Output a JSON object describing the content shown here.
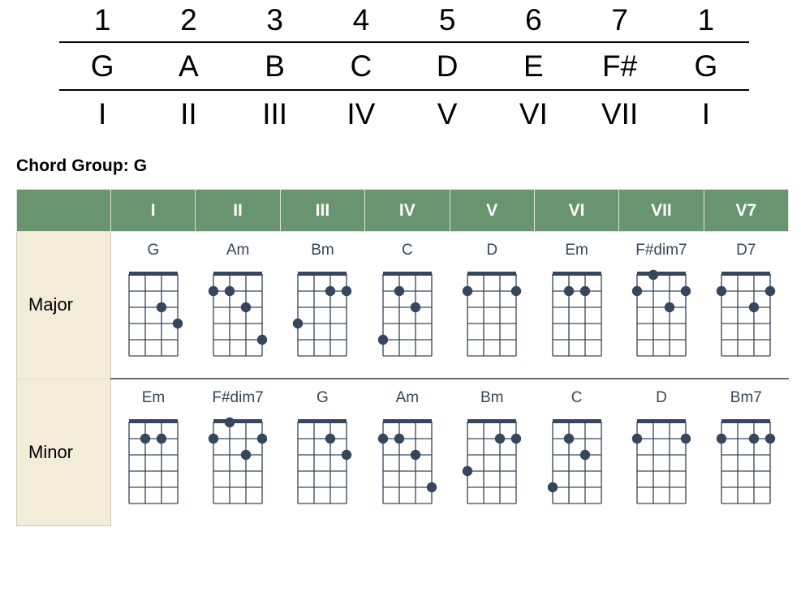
{
  "scale_table": {
    "degrees": [
      "1",
      "2",
      "3",
      "4",
      "5",
      "6",
      "7",
      "1"
    ],
    "notes": [
      "G",
      "A",
      "B",
      "C",
      "D",
      "E",
      "F#",
      "G"
    ],
    "romans": [
      "I",
      "II",
      "III",
      "IV",
      "V",
      "VI",
      "VII",
      "I"
    ]
  },
  "chord_group_heading": "Chord Group: G",
  "colors": {
    "header_green": "#699470",
    "row_label_beige": "#f3ecd9",
    "diagram_ink": "#36465c",
    "divider": "#6b6b6b"
  },
  "chord_table": {
    "corner_label": "",
    "columns": [
      "I",
      "II",
      "III",
      "IV",
      "V",
      "VI",
      "VII",
      "V7"
    ],
    "rows": [
      {
        "label": "Major",
        "chords": [
          {
            "name": "G",
            "strings": 4,
            "frets": 5,
            "dots": [
              [
                3,
                2
              ],
              [
                4,
                3
              ]
            ]
          },
          {
            "name": "Am",
            "strings": 4,
            "frets": 5,
            "dots": [
              [
                1,
                1
              ],
              [
                2,
                1
              ],
              [
                3,
                2
              ],
              [
                4,
                4
              ]
            ]
          },
          {
            "name": "Bm",
            "strings": 4,
            "frets": 5,
            "dots": [
              [
                3,
                1
              ],
              [
                4,
                1
              ],
              [
                1,
                3
              ]
            ]
          },
          {
            "name": "C",
            "strings": 4,
            "frets": 5,
            "dots": [
              [
                2,
                1
              ],
              [
                3,
                2
              ],
              [
                1,
                4
              ]
            ]
          },
          {
            "name": "D",
            "strings": 4,
            "frets": 5,
            "dots": [
              [
                1,
                1
              ],
              [
                4,
                1
              ]
            ]
          },
          {
            "name": "Em",
            "strings": 4,
            "frets": 5,
            "dots": [
              [
                2,
                1
              ],
              [
                3,
                1
              ]
            ]
          },
          {
            "name": "F#dim7",
            "strings": 4,
            "frets": 5,
            "dots": [
              [
                2,
                0
              ],
              [
                1,
                1
              ],
              [
                4,
                1
              ],
              [
                3,
                2
              ]
            ]
          },
          {
            "name": "D7",
            "strings": 4,
            "frets": 5,
            "dots": [
              [
                1,
                1
              ],
              [
                4,
                1
              ],
              [
                3,
                2
              ]
            ]
          }
        ]
      },
      {
        "label": "Minor",
        "chords": [
          {
            "name": "Em",
            "strings": 4,
            "frets": 5,
            "dots": [
              [
                2,
                1
              ],
              [
                3,
                1
              ]
            ]
          },
          {
            "name": "F#dim7",
            "strings": 4,
            "frets": 5,
            "dots": [
              [
                2,
                0
              ],
              [
                1,
                1
              ],
              [
                4,
                1
              ],
              [
                3,
                2
              ]
            ]
          },
          {
            "name": "G",
            "strings": 4,
            "frets": 5,
            "dots": [
              [
                3,
                1
              ],
              [
                4,
                2
              ]
            ]
          },
          {
            "name": "Am",
            "strings": 4,
            "frets": 5,
            "dots": [
              [
                1,
                1
              ],
              [
                2,
                1
              ],
              [
                3,
                2
              ],
              [
                4,
                4
              ]
            ]
          },
          {
            "name": "Bm",
            "strings": 4,
            "frets": 5,
            "dots": [
              [
                3,
                1
              ],
              [
                4,
                1
              ],
              [
                1,
                3
              ]
            ]
          },
          {
            "name": "C",
            "strings": 4,
            "frets": 5,
            "dots": [
              [
                2,
                1
              ],
              [
                3,
                2
              ],
              [
                1,
                4
              ]
            ]
          },
          {
            "name": "D",
            "strings": 4,
            "frets": 5,
            "dots": [
              [
                1,
                1
              ],
              [
                4,
                1
              ]
            ]
          },
          {
            "name": "Bm7",
            "strings": 4,
            "frets": 5,
            "dots": [
              [
                1,
                1
              ],
              [
                3,
                1
              ],
              [
                4,
                1
              ]
            ]
          }
        ]
      }
    ]
  }
}
